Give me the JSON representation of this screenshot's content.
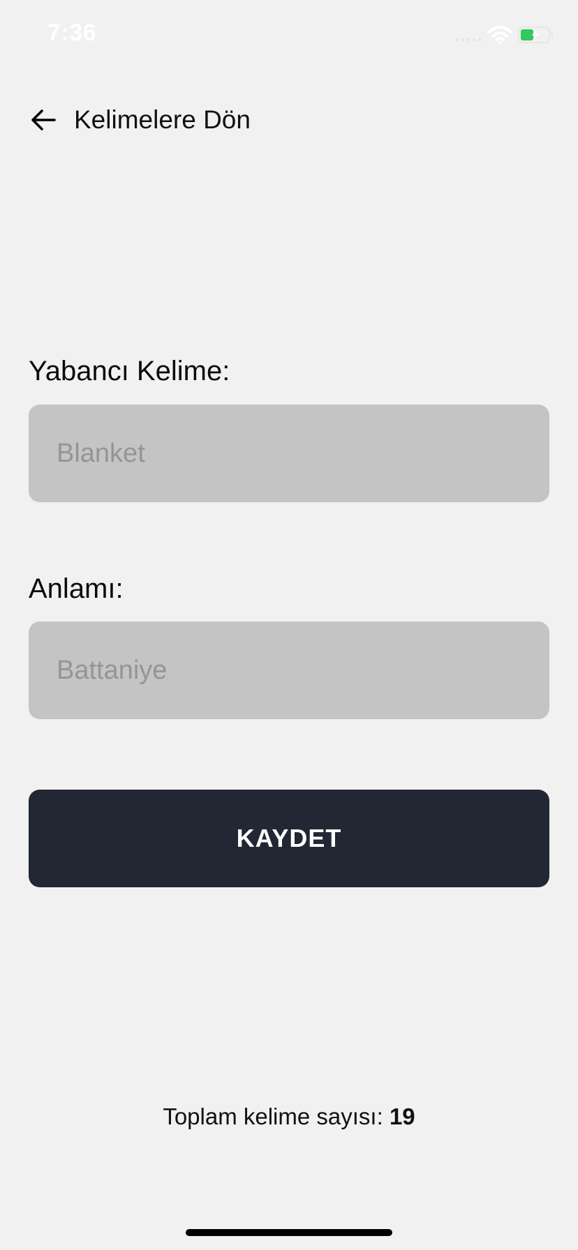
{
  "status_bar": {
    "time": "7:36",
    "icons": [
      "cellular-signal-icon",
      "wifi-icon",
      "battery-charging-icon"
    ],
    "battery_color": "#34c759"
  },
  "header": {
    "back_icon": "arrow-left-icon",
    "back_label": "Kelimelere Dön"
  },
  "form": {
    "foreign_word": {
      "label": "Yabancı Kelime:",
      "placeholder": "Blanket",
      "value": ""
    },
    "meaning": {
      "label": "Anlamı:",
      "placeholder": "Battaniye",
      "value": ""
    },
    "save_label": "KAYDET"
  },
  "footer": {
    "word_count_label": "Toplam kelime sayısı:",
    "word_count_value": "19"
  },
  "colors": {
    "background": "#f1f1f1",
    "input_background": "#c4c4c4",
    "button_background": "#212733",
    "button_text": "#ffffff"
  }
}
